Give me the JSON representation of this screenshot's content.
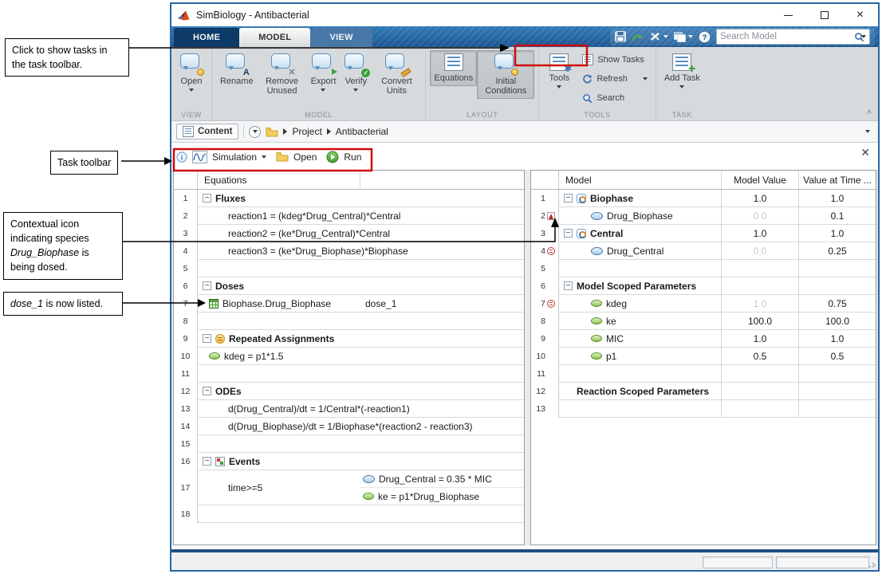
{
  "annotations": {
    "callout_show_tasks": {
      "segments": [
        {
          "t": "Click to show tasks in the task toolbar."
        }
      ]
    },
    "callout_task_toolbar": {
      "segments": [
        {
          "t": "Task toolbar"
        }
      ]
    },
    "callout_contextual_icon": {
      "segments": [
        {
          "t": "Contextual icon indicating species "
        },
        {
          "t": "Drug_Biophase",
          "i": true
        },
        {
          "t": " is being dosed."
        }
      ]
    },
    "callout_dose_listed": {
      "segments": [
        {
          "t": "dose_1",
          "i": true
        },
        {
          "t": " is now listed."
        }
      ]
    }
  },
  "window": {
    "title": "SimBiology - Antibacterial",
    "search_placeholder": "Search Model"
  },
  "tabs": [
    {
      "label": "HOME"
    },
    {
      "label": "MODEL"
    },
    {
      "label": "VIEW"
    }
  ],
  "ribbon": {
    "sections": [
      {
        "name": "VIEW",
        "items": [
          {
            "label": "Open"
          }
        ]
      },
      {
        "name": "MODEL",
        "items": [
          {
            "label": "Rename"
          },
          {
            "label": "Remove Unused"
          },
          {
            "label": "Export"
          },
          {
            "label": "Verify"
          },
          {
            "label": "Convert Units"
          }
        ]
      },
      {
        "name": "LAYOUT",
        "items": [
          {
            "label": "Equations"
          },
          {
            "label": "Initial Conditions"
          }
        ]
      },
      {
        "name": "TOOLS",
        "items": [
          {
            "label": "Tools"
          }
        ],
        "small": [
          {
            "label": "Show Tasks"
          },
          {
            "label": "Refresh"
          },
          {
            "label": "Search"
          }
        ]
      },
      {
        "name": "TASK",
        "items": [
          {
            "label": "Add Task"
          }
        ]
      }
    ]
  },
  "breadcrumb": {
    "content": "Content",
    "path": [
      "Project",
      "Antibacterial"
    ]
  },
  "task_toolbar": {
    "simulation": "Simulation",
    "open": "Open",
    "run": "Run"
  },
  "equations_panel": {
    "header": "Equations",
    "rows": [
      {
        "num": "1",
        "type": "category",
        "label": "Fluxes"
      },
      {
        "num": "2",
        "type": "equation",
        "text": "reaction1 = (kdeg*Drug_Central)*Central"
      },
      {
        "num": "3",
        "type": "equation",
        "text": "reaction2 = (ke*Drug_Central)*Central"
      },
      {
        "num": "4",
        "type": "equation",
        "text": "reaction3 = (ke*Drug_Biophase)*Biophase"
      },
      {
        "num": "5",
        "type": "empty"
      },
      {
        "num": "6",
        "type": "category",
        "label": "Doses"
      },
      {
        "num": "7",
        "type": "dose",
        "icon": "dose-table",
        "text": "Biophase.Drug_Biophase",
        "text2": "dose_1"
      },
      {
        "num": "8",
        "type": "empty"
      },
      {
        "num": "9",
        "type": "category",
        "icon": "repeated",
        "label": "Repeated Assignments"
      },
      {
        "num": "10",
        "type": "item",
        "icon": "parameter",
        "text": "kdeg = p1*1.5"
      },
      {
        "num": "11",
        "type": "empty"
      },
      {
        "num": "12",
        "type": "category",
        "label": "ODEs"
      },
      {
        "num": "13",
        "type": "equation",
        "text": "d(Drug_Central)/dt = 1/Central*(-reaction1)"
      },
      {
        "num": "14",
        "type": "equation",
        "text": "d(Drug_Biophase)/dt = 1/Biophase*(reaction2 - reaction3)"
      },
      {
        "num": "15",
        "type": "empty"
      },
      {
        "num": "16",
        "type": "category",
        "icon": "events",
        "label": "Events"
      },
      {
        "num": "17",
        "type": "event",
        "trigger": "time>=5",
        "actions": [
          {
            "icon": "species",
            "text": "Drug_Central = 0.35 * MIC"
          },
          {
            "icon": "parameter",
            "text": "ke = p1*Drug_Biophase"
          }
        ]
      },
      {
        "num": "18",
        "type": "empty"
      }
    ]
  },
  "model_panel": {
    "headers": [
      "Model",
      "Model Value",
      "Value at Time ..."
    ],
    "rows": [
      {
        "num": "1",
        "type": "compartment",
        "icon": "compartment",
        "name": "Biophase",
        "model_value": "1.0",
        "time_value": "1.0"
      },
      {
        "num": "2",
        "type": "species",
        "gutter": "dose",
        "icon": "species",
        "name": "Drug_Biophase",
        "model_value": "0.0",
        "time_value": "0.1",
        "mv_gray": true
      },
      {
        "num": "3",
        "type": "compartment",
        "icon": "compartment",
        "name": "Central",
        "model_value": "1.0",
        "time_value": "1.0"
      },
      {
        "num": "4",
        "type": "species",
        "gutter": "rule",
        "icon": "species",
        "name": "Drug_Central",
        "model_value": "0.0",
        "time_value": "0.25",
        "mv_gray": true
      },
      {
        "num": "5",
        "type": "empty"
      },
      {
        "num": "6",
        "type": "group",
        "name": "Model Scoped Parameters"
      },
      {
        "num": "7",
        "type": "param",
        "gutter": "rule",
        "icon": "parameter",
        "name": "kdeg",
        "model_value": "1.0",
        "time_value": "0.75",
        "mv_gray": true
      },
      {
        "num": "8",
        "type": "param",
        "icon": "parameter",
        "name": "ke",
        "model_value": "100.0",
        "time_value": "100.0"
      },
      {
        "num": "9",
        "type": "param",
        "icon": "parameter",
        "name": "MIC",
        "model_value": "1.0",
        "time_value": "1.0"
      },
      {
        "num": "10",
        "type": "param",
        "icon": "parameter",
        "name": "p1",
        "model_value": "0.5",
        "time_value": "0.5"
      },
      {
        "num": "11",
        "type": "empty"
      },
      {
        "num": "12",
        "type": "plain",
        "name": "Reaction Scoped Parameters"
      },
      {
        "num": "13",
        "type": "empty"
      }
    ]
  }
}
